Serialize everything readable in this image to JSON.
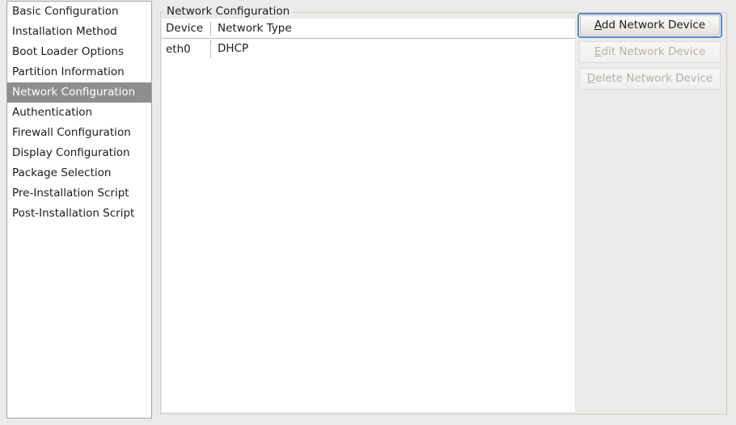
{
  "sidebar": {
    "items": [
      {
        "label": "Basic Configuration",
        "selected": false
      },
      {
        "label": "Installation Method",
        "selected": false
      },
      {
        "label": "Boot Loader Options",
        "selected": false
      },
      {
        "label": "Partition Information",
        "selected": false
      },
      {
        "label": "Network Configuration",
        "selected": true
      },
      {
        "label": "Authentication",
        "selected": false
      },
      {
        "label": "Firewall Configuration",
        "selected": false
      },
      {
        "label": "Display Configuration",
        "selected": false
      },
      {
        "label": "Package Selection",
        "selected": false
      },
      {
        "label": "Pre-Installation Script",
        "selected": false
      },
      {
        "label": "Post-Installation Script",
        "selected": false
      }
    ]
  },
  "groupbox": {
    "label": "Network Configuration"
  },
  "table": {
    "columns": [
      "Device",
      "Network Type"
    ],
    "rows": [
      {
        "device": "eth0",
        "network_type": "DHCP"
      }
    ]
  },
  "buttons": {
    "add": {
      "mnemonic": "A",
      "rest": "dd Network Device",
      "full_label": "Add Network Device",
      "state": "focused"
    },
    "edit": {
      "mnemonic": "E",
      "rest": "dit Network Device",
      "full_label": "Edit Network Device",
      "state": "disabled"
    },
    "delete": {
      "mnemonic": "D",
      "rest": "elete Network Device",
      "full_label": "Delete Network Device",
      "state": "disabled"
    }
  },
  "colors": {
    "window_background": "#edebe9",
    "list_background": "#ffffff",
    "selection_background": "#8e8e8e",
    "selection_text": "#ffffff",
    "focus_ring": "#5187c4",
    "disabled_text": "#b4b1ae",
    "border": "#a8a5a2"
  }
}
